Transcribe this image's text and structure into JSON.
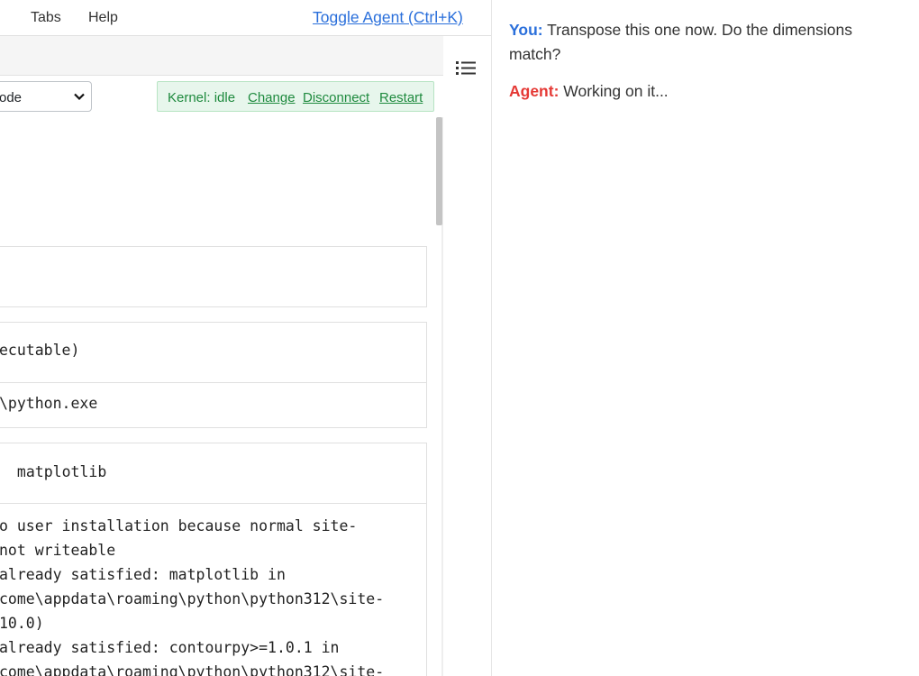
{
  "menu": {
    "items": [
      "Tabs",
      "Help"
    ],
    "toggle_agent": "Toggle Agent (Ctrl+K)"
  },
  "toolbar": {
    "cell_type": "ode",
    "kernel_status": "Kernel: idle",
    "kernel_actions": [
      "Change",
      "Disconnect",
      "Restart"
    ]
  },
  "cells": {
    "cell3_code": "ecutable)",
    "cell3_output": "\\python.exe",
    "cell4_code": " matplotlib",
    "cell4_output": [
      "o user installation because normal site-",
      "not writeable",
      "already satisfied: matplotlib in",
      "come\\appdata\\roaming\\python\\python312\\site-",
      "10.0)",
      "already satisfied: contourpy>=1.0.1 in",
      "come\\appdata\\roaming\\python\\python312\\site-"
    ]
  },
  "chat": {
    "you_label": "You:",
    "you_text": " Transpose this one now. Do the dimensions match?",
    "agent_label": "Agent:",
    "agent_text_a": " Working",
    "agent_text_b": " on it..."
  }
}
